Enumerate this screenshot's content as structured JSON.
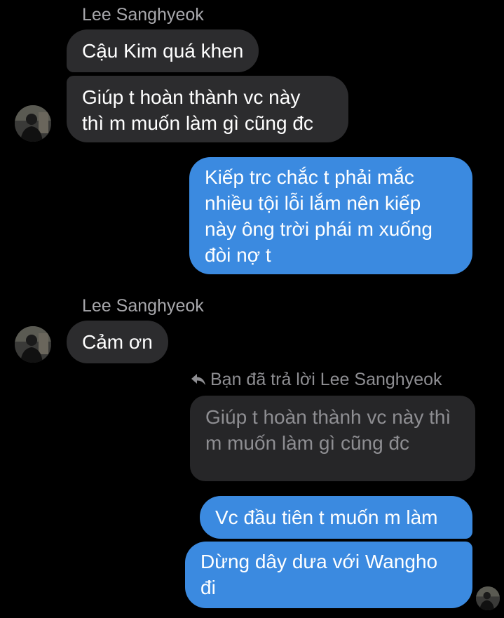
{
  "messages": {
    "sender1": "Lee Sanghyeok",
    "msg1": "Cậu Kim quá khen",
    "msg2": "Giúp t hoàn thành vc này\nthì m muốn làm gì cũng đc",
    "msg3": "Kiếp trc chắc t phải mắc\nnhiều tội lỗi lắm nên kiếp\nnày ông trời phái m xuống\nđòi nợ t",
    "sender2": "Lee Sanghyeok",
    "msg4": "Cảm ơn",
    "reply_label": "Bạn đã trả lời Lee Sanghyeok",
    "quoted": "Giúp t hoàn thành vc này thì\nm muốn làm gì cũng đc",
    "msg5": "Vc đầu tiên t muốn m làm",
    "msg6": "Dừng dây dưa với Wangho\nđi"
  },
  "icons": {
    "reply": "reply-arrow-icon",
    "avatar": "avatar-photo"
  },
  "colors": {
    "background": "#000000",
    "incoming_bubble": "#2c2c2e",
    "outgoing_bubble": "#3b8ae0",
    "meta_text": "#a8a8ac"
  }
}
